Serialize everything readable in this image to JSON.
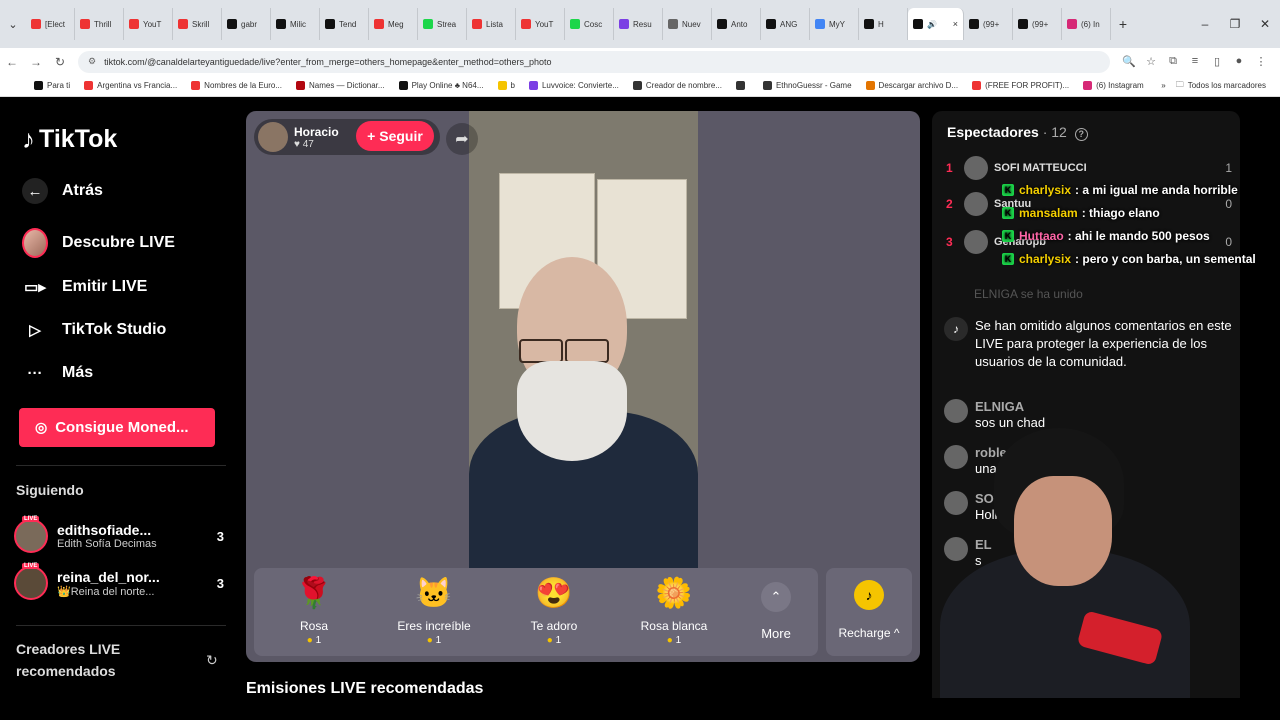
{
  "browser": {
    "tabs": [
      {
        "label": "[Elect",
        "color": "#e33"
      },
      {
        "label": "Thrill",
        "color": "#e33"
      },
      {
        "label": "YouT",
        "color": "#e33"
      },
      {
        "label": "Skrill",
        "color": "#e33"
      },
      {
        "label": "gabr",
        "color": "#111"
      },
      {
        "label": "Milic",
        "color": "#111"
      },
      {
        "label": "Tend",
        "color": "#111"
      },
      {
        "label": "Meg",
        "color": "#e33"
      },
      {
        "label": "Strea",
        "color": "#1cd64a"
      },
      {
        "label": "Lista",
        "color": "#e33"
      },
      {
        "label": "YouT",
        "color": "#e33"
      },
      {
        "label": "Cosc",
        "color": "#1cd64a"
      },
      {
        "label": "Resu",
        "color": "#7b3fe4"
      },
      {
        "label": "Nuev",
        "color": "#666"
      },
      {
        "label": "Anto",
        "color": "#111"
      },
      {
        "label": "ANG",
        "color": "#111"
      },
      {
        "label": "MyY",
        "color": "#4285f4"
      },
      {
        "label": "H",
        "color": "#111"
      }
    ],
    "active_tab": {
      "label": "",
      "close": "×"
    },
    "trailing_tabs": [
      {
        "label": "(99+",
        "color": "#111"
      },
      {
        "label": "(99+",
        "color": "#111"
      },
      {
        "label": "(6) In",
        "color": "#d62976"
      }
    ],
    "new_tab": "+",
    "url": "tiktok.com/@canaldelarteyantiguedade/live?enter_from_merge=others_homepage&enter_method=others_photo",
    "bookmarks": [
      {
        "label": "Para ti",
        "color": "#111"
      },
      {
        "label": "Argentina vs Francia...",
        "color": "#e33"
      },
      {
        "label": "Nombres de la Euro...",
        "color": "#e33"
      },
      {
        "label": "Names — Dictionar...",
        "color": "#b20710"
      },
      {
        "label": "Play Online ♣ N64...",
        "color": "#111"
      },
      {
        "label": "b",
        "color": "#f5c400"
      },
      {
        "label": "Luvvoice: Convierte...",
        "color": "#7b3fe4"
      },
      {
        "label": "Creador de nombre...",
        "color": "#333"
      },
      {
        "label": "",
        "color": "#333"
      },
      {
        "label": "EthnoGuessr - Game",
        "color": "#333"
      },
      {
        "label": "Descargar archivo D...",
        "color": "#e37400"
      },
      {
        "label": "(FREE FOR PROFIT)...",
        "color": "#e33"
      },
      {
        "label": "(6) Instagram",
        "color": "#d62976"
      }
    ],
    "bookmarks_more": "»",
    "all_bookmarks": "Todos los marcadores"
  },
  "sidebar": {
    "logo": "TikTok",
    "back": "Atrás",
    "nav": [
      {
        "label": "Descubre LIVE"
      },
      {
        "label": "Emitir LIVE"
      },
      {
        "label": "TikTok Studio"
      },
      {
        "label": "Más"
      }
    ],
    "coins_button": "Consigue Moned...",
    "following_label": "Siguiendo",
    "following": [
      {
        "username": "edithsofiade...",
        "display": "Edith Sofía Decimas",
        "count": "3",
        "badge": "LIVE"
      },
      {
        "username": "reina_del_nor...",
        "display": "👑Reina del norte...",
        "count": "3",
        "badge": "LIVE"
      }
    ],
    "recommended_label_1": "Creadores LIVE",
    "recommended_label_2": "recomendados"
  },
  "live": {
    "host_name": "Horacio",
    "host_likes": "♥ 47",
    "follow_button": "+ Seguir",
    "gifts": [
      {
        "name": "Rosa",
        "price": "1",
        "icon": "🌹"
      },
      {
        "name": "Eres increíble",
        "price": "1",
        "icon": "🐱"
      },
      {
        "name": "Te adoro",
        "price": "1",
        "icon": "😍"
      },
      {
        "name": "Rosa blanca",
        "price": "1",
        "icon": "🌼"
      }
    ],
    "more_label": "More",
    "recharge_label": "Recharge ^",
    "recommended_title": "Emisiones LIVE recomendadas"
  },
  "chat": {
    "spectators_label": "Espectadores",
    "spectators_count": "· 12",
    "ranking": [
      {
        "rank": "1",
        "name": "SOFI MATTEUCCI",
        "score": "1"
      },
      {
        "rank": "2",
        "name": "Santuu",
        "score": "0"
      },
      {
        "rank": "3",
        "name": "Genaropb",
        "score": "0"
      }
    ],
    "joined": "ELNIGA  se ha unido",
    "system_message": "Se han omitido algunos comentarios en este LIVE para proteger la experiencia de los usuarios de la comunidad.",
    "messages": [
      {
        "user": "ELNIGA",
        "text": "sos un chad"
      },
      {
        "user": "roblesss",
        "text": "uname don"
      },
      {
        "user": "SOFI MAT",
        "text": "Holiii"
      },
      {
        "user": "EL",
        "text": "s"
      }
    ]
  },
  "stream_overlay": [
    {
      "user": "charlysix",
      "text": ": a mi igual me anda horrible"
    },
    {
      "user": "mansalam",
      "text": ": thiago elano"
    },
    {
      "user": "Huttaao",
      "text": ": ahi le mando 500 pesos"
    },
    {
      "user": "charlysix",
      "text": ": pero y con barba, un semental"
    }
  ]
}
